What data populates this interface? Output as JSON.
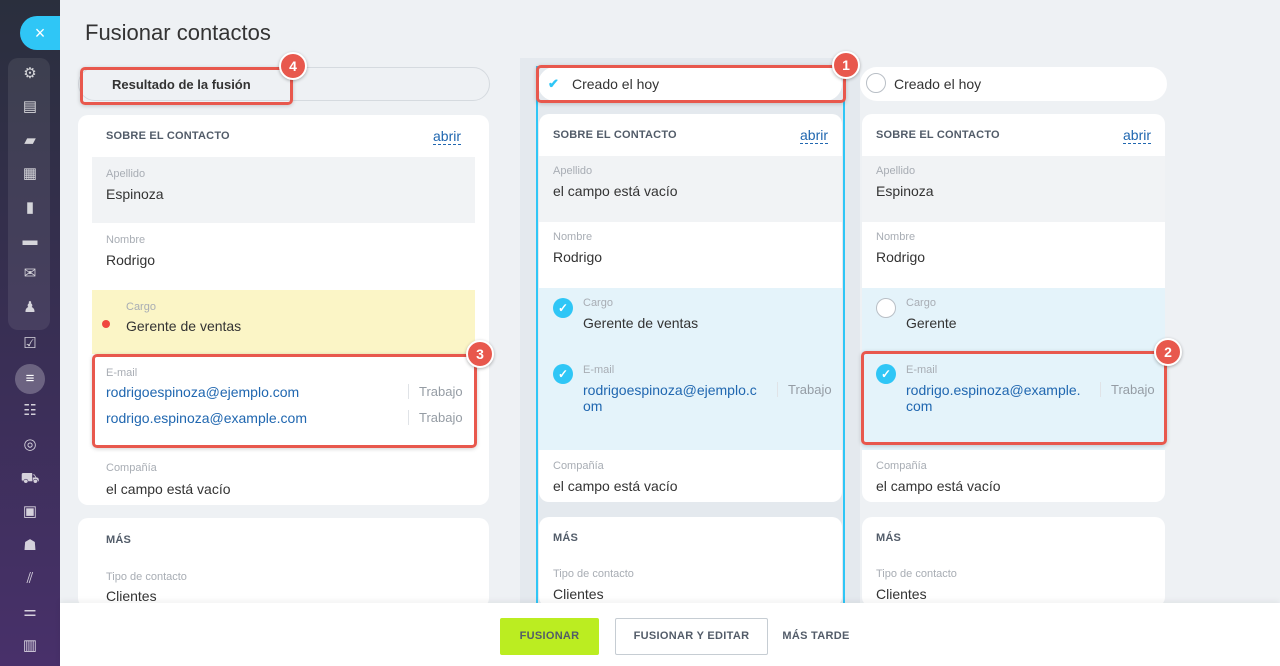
{
  "page_title": "Fusionar contactos",
  "close_icon": "×",
  "sidebar_icons": [
    "activity-icon",
    "feed-icon",
    "chat-icon",
    "calendar-icon",
    "docs-icon",
    "drive-icon",
    "mail-icon",
    "groups-icon",
    "tasks-icon",
    "crm-icon",
    "list-icon",
    "target-icon",
    "cart-icon",
    "contact-card-icon",
    "robot-icon",
    "marketing-icon",
    "settings-sliders-icon",
    "analytics-icon"
  ],
  "badges": {
    "b1": "1",
    "b2": "2",
    "b3": "3",
    "b4": "4"
  },
  "result_column": {
    "tab_label": "Resultado de la fusión",
    "section_title": "SOBRE EL CONTACTO",
    "open_link": "abrir",
    "fields": {
      "apellido": {
        "label": "Apellido",
        "value": "Espinoza"
      },
      "nombre": {
        "label": "Nombre",
        "value": "Rodrigo"
      },
      "cargo": {
        "label": "Cargo",
        "value": "Gerente de ventas"
      },
      "email": {
        "label": "E-mail",
        "values": [
          {
            "value": "rodrigoespinoza@ejemplo.com",
            "type": "Trabajo"
          },
          {
            "value": "rodrigo.espinoza@example.com",
            "type": "Trabajo"
          }
        ]
      },
      "compania": {
        "label": "Compañía",
        "value": "el campo está vacío"
      }
    },
    "more_title": "MÁS",
    "tipo": {
      "label": "Tipo de contacto",
      "value": "Clientes"
    }
  },
  "source_a": {
    "tab_label": "Creado el hoy",
    "section_title": "SOBRE EL CONTACTO",
    "open_link": "abrir",
    "fields": {
      "apellido": {
        "label": "Apellido",
        "value": "el campo está vacío"
      },
      "nombre": {
        "label": "Nombre",
        "value": "Rodrigo"
      },
      "cargo": {
        "label": "Cargo",
        "value": "Gerente de ventas"
      },
      "email": {
        "label": "E-mail",
        "line1": "rodrigoespinoza@ejemplo.c",
        "line2": "om",
        "type": "Trabajo"
      },
      "compania": {
        "label": "Compañía",
        "value": "el campo está vacío"
      }
    },
    "more_title": "MÁS",
    "tipo": {
      "label": "Tipo de contacto",
      "value": "Clientes"
    }
  },
  "source_b": {
    "tab_label": "Creado el hoy",
    "section_title": "SOBRE EL CONTACTO",
    "open_link": "abrir",
    "fields": {
      "apellido": {
        "label": "Apellido",
        "value": "Espinoza"
      },
      "nombre": {
        "label": "Nombre",
        "value": "Rodrigo"
      },
      "cargo": {
        "label": "Cargo",
        "value": "Gerente"
      },
      "email": {
        "label": "E-mail",
        "line1": "rodrigo.espinoza@example.",
        "line2": "com",
        "type": "Trabajo"
      },
      "compania": {
        "label": "Compañía",
        "value": "el campo está vacío"
      }
    },
    "more_title": "MÁS",
    "tipo": {
      "label": "Tipo de contacto",
      "value": "Clientes"
    }
  },
  "footer": {
    "merge": "FUSIONAR",
    "merge_edit": "FUSIONAR Y EDITAR",
    "later": "MÁS TARDE"
  },
  "colors": {
    "accent": "#2fc6f6",
    "highlight": "#e8584d",
    "primary_button": "#bbed21",
    "changed_row": "#fbf5c6",
    "selected_row": "#e4f3fa"
  }
}
